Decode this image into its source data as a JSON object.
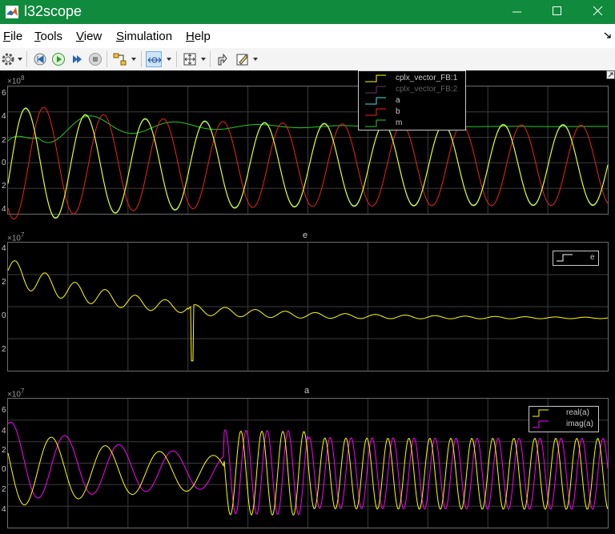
{
  "window": {
    "title": "l32scope",
    "app_icon": "matlab-icon",
    "title_bar_color": "#108a3c",
    "controls": [
      "minimize-icon",
      "maximize-icon",
      "close-icon"
    ]
  },
  "menu": {
    "items": [
      {
        "hot": "F",
        "rest": "ile"
      },
      {
        "hot": "T",
        "rest": "ools"
      },
      {
        "hot": "V",
        "rest": "iew"
      },
      {
        "hot": "S",
        "rest": "imulation"
      },
      {
        "hot": "H",
        "rest": "elp"
      }
    ]
  },
  "toolbar": {
    "icons": [
      "gear-icon",
      "step-back-icon",
      "run-icon",
      "step-forward-icon",
      "stop-icon",
      "highlight-block-icon",
      "zoom-time-icon",
      "autoscale-icon",
      "restore-layout-icon",
      "properties-icon"
    ]
  },
  "colors": {
    "yellow": "#ffff00",
    "magenta": "#ff00ff",
    "cyan": "#40e0e0",
    "red": "#ee2222",
    "green": "#22cc22",
    "grid": "#3c3c3c",
    "text": "#c8c8c8"
  },
  "plots": [
    {
      "title": "",
      "exponent_base": "×10",
      "exponent_power": "8",
      "y_tick_labels": [
        "6",
        "4",
        "2",
        "0",
        "2",
        "4"
      ],
      "ylim": [
        -4,
        6.5
      ],
      "legend": [
        {
          "label": "cplx_vector_FB:1",
          "color": "#ffff00",
          "enabled": true
        },
        {
          "label": "cplx_vector_FB:2",
          "color": "#808080",
          "enabled": false
        },
        {
          "label": "a",
          "color": "#40e0e0",
          "enabled": true
        },
        {
          "label": "b",
          "color": "#ee2222",
          "enabled": true
        },
        {
          "label": "m",
          "color": "#22cc22",
          "enabled": true
        }
      ]
    },
    {
      "title": "e",
      "exponent_base": "×10",
      "exponent_power": "7",
      "y_tick_labels": [
        "4",
        "2",
        "0",
        "2"
      ],
      "ylim": [
        -3.3,
        4.5
      ],
      "legend": [
        {
          "label": "e",
          "color": "#ffffff",
          "enabled": true
        }
      ]
    },
    {
      "title": "a",
      "exponent_base": "×10",
      "exponent_power": "7",
      "y_tick_labels": [
        "6",
        "4",
        "2",
        "0",
        "2",
        "4"
      ],
      "ylim": [
        -5,
        7
      ],
      "legend": [
        {
          "label": "real(a)",
          "color": "#ffff00",
          "enabled": true
        },
        {
          "label": "imag(a)",
          "color": "#ff00ff",
          "enabled": true
        }
      ]
    }
  ]
}
